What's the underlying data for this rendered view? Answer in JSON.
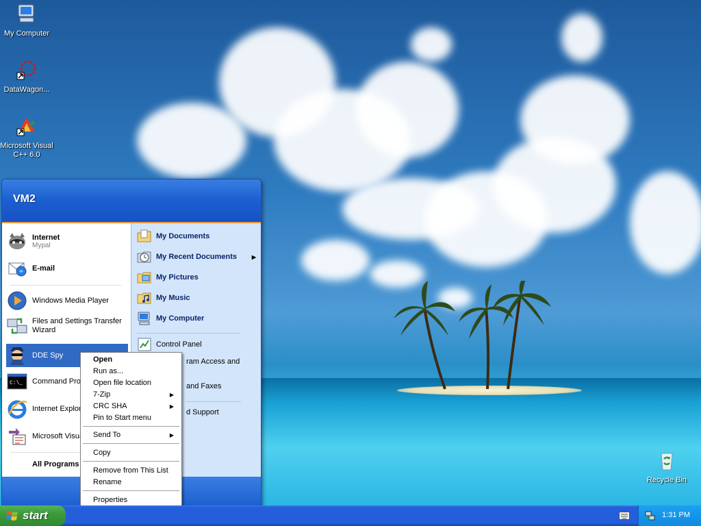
{
  "desktop": {
    "icons": [
      {
        "label": "My Computer",
        "icon": "my-computer-icon"
      },
      {
        "label": "DataWagon...",
        "icon": "datawagon-icon"
      },
      {
        "label": "Microsoft Visual C++ 6.0",
        "icon": "visual-cpp-icon"
      },
      {
        "label": "Recycle Bin",
        "icon": "recycle-bin-icon"
      }
    ]
  },
  "start_menu": {
    "user": "VM2",
    "pinned": [
      {
        "title": "Internet",
        "subtitle": "Mypal",
        "icon": "raccoon-browser-icon"
      },
      {
        "title": "E-mail",
        "icon": "email-icon"
      }
    ],
    "recent": [
      {
        "label": "Windows Media Player",
        "icon": "media-player-icon"
      },
      {
        "label": "Files and Settings Transfer Wizard",
        "icon": "transfer-wizard-icon"
      },
      {
        "label": "DDE Spy",
        "icon": "dde-spy-icon"
      },
      {
        "label": "Command Prom",
        "icon": "command-prompt-icon"
      },
      {
        "label": "Internet Explor",
        "icon": "internet-explorer-icon"
      },
      {
        "label": "Microsoft Visua",
        "icon": "visual-studio-tool-icon"
      }
    ],
    "all_programs": "All Programs",
    "right_items": [
      {
        "label": "My Documents",
        "icon": "folder-documents-icon"
      },
      {
        "label": "My Recent Documents",
        "icon": "recent-documents-icon"
      },
      {
        "label": "My Pictures",
        "icon": "folder-pictures-icon"
      },
      {
        "label": "My Music",
        "icon": "folder-music-icon"
      },
      {
        "label": "My Computer",
        "icon": "my-computer-icon"
      },
      {
        "label": "Control Panel",
        "icon": "control-panel-icon"
      },
      {
        "label": "ram Access and",
        "icon": "program-access-icon"
      },
      {
        "label": "and Faxes",
        "icon": "printers-icon"
      },
      {
        "label": "d Support",
        "icon": "help-icon"
      }
    ]
  },
  "context_menu": {
    "items": [
      "Open",
      "Run as...",
      "Open file location",
      "7-Zip",
      "CRC SHA",
      "Pin to Start menu",
      "Send To",
      "Copy",
      "Remove from This List",
      "Rename",
      "Properties"
    ]
  },
  "taskbar": {
    "start_label": "start",
    "clock": "1:31 PM"
  },
  "colors": {
    "highlight": "#316ac5",
    "start_green": "#3c9a3c",
    "taskbar_blue": "#245edb"
  }
}
